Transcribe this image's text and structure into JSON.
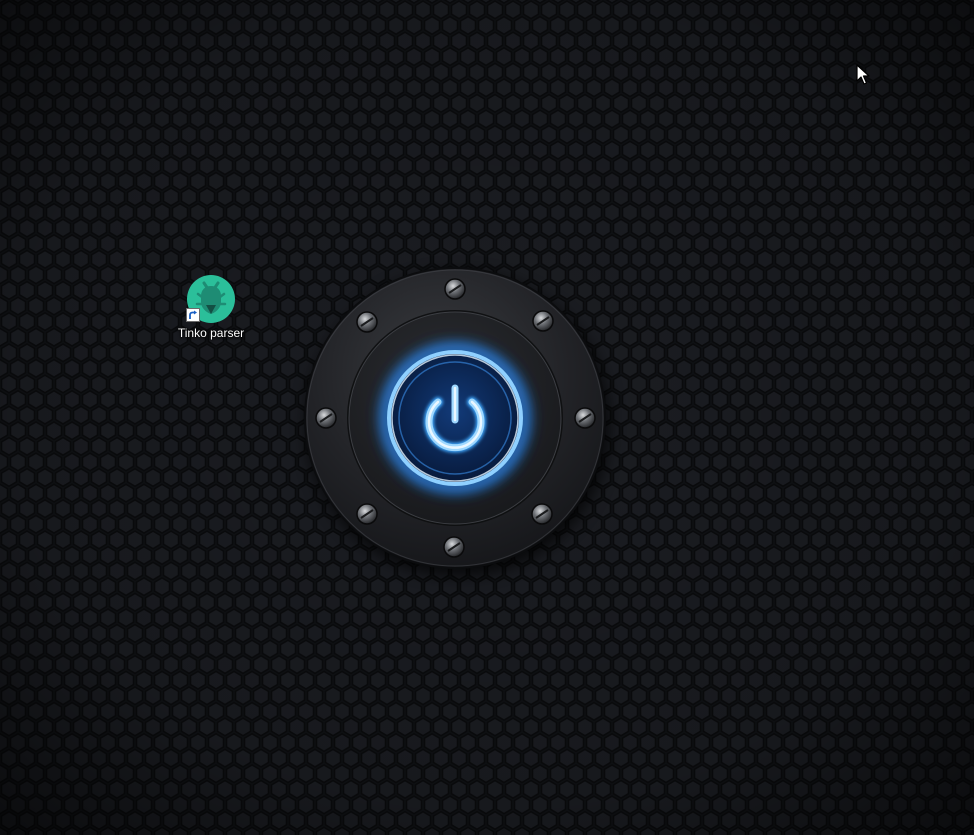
{
  "desktop": {
    "icons": [
      {
        "label": "Tinko parser",
        "icon": "tinko-parser-app-icon",
        "shortcut": true
      }
    ]
  },
  "wallpaper": {
    "description_icon": "power-button-icon",
    "bolts": 8,
    "glow_color": "#3fa9ff",
    "background_color": "#111317",
    "icon_color": "#2bbf9a"
  },
  "cursor": {
    "icon": "arrow-cursor-icon"
  }
}
